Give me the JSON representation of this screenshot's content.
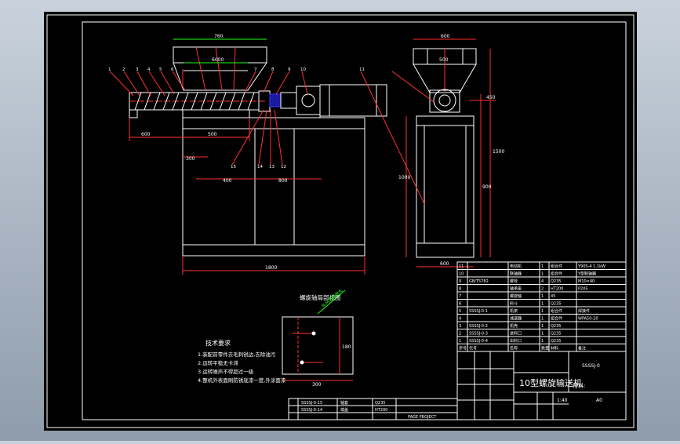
{
  "title_block": {
    "title": "10型螺旋输送机",
    "drawing_no": "SSSSJ-0",
    "material_label": "材料:",
    "sheet_marks": [
      "A0",
      "1:40"
    ]
  },
  "notes": {
    "heading": "技术要求",
    "items": [
      "1.装配前零件去毛刺锐边,去除油污",
      "2.运转平稳无卡滞",
      "3.运转噪声不得超过一级",
      "4.整机外表面刷防锈底漆一度,外涂面漆"
    ]
  },
  "detail": {
    "title": "螺旋轴局部视图",
    "callout": "N-M局部放大",
    "width_label": "300",
    "height_label": "180"
  },
  "main_dims": {
    "hopper_top": "760",
    "hopper_inner": "6000",
    "left_span": "600",
    "base_height": "300",
    "base_width": "400",
    "mid_width": "800",
    "total_length": "1800",
    "mid_label": "500"
  },
  "side_dims": {
    "top_width": "600",
    "inner_width": "500",
    "total_height": "1500",
    "frame_height": "900",
    "base_height": "1000",
    "bottom_width": "600",
    "gear_label": "450"
  },
  "balloons": {
    "left": [
      "1",
      "2",
      "3",
      "4",
      "5",
      "6",
      "7",
      "8"
    ],
    "right": [
      "9",
      "10"
    ],
    "bottom": [
      "15",
      "14",
      "13",
      "12"
    ],
    "side": [
      "11"
    ]
  },
  "parts_list": {
    "rows": [
      {
        "no": "11",
        "code": "",
        "name": "电动机",
        "qty": "1",
        "mat": "组合件",
        "note": "Y90S-4 1.1kW"
      },
      {
        "no": "10",
        "code": "",
        "name": "联轴器",
        "qty": "1",
        "mat": "组合件",
        "note": "Y型联轴器"
      },
      {
        "no": "9",
        "code": "GB/T5782",
        "name": "螺栓",
        "qty": "4",
        "mat": "Q235",
        "note": "M10×40"
      },
      {
        "no": "8",
        "code": "",
        "name": "轴承座",
        "qty": "2",
        "mat": "HT200",
        "note": "P205"
      },
      {
        "no": "7",
        "code": "",
        "name": "螺旋轴",
        "qty": "1",
        "mat": "45",
        "note": ""
      },
      {
        "no": "6",
        "code": "",
        "name": "料斗",
        "qty": "1",
        "mat": "Q235",
        "note": ""
      },
      {
        "no": "5",
        "code": "SSSSJ-0-1",
        "name": "机架",
        "qty": "1",
        "mat": "组合件",
        "note": "焊接件"
      },
      {
        "no": "4",
        "code": "",
        "name": "减速器",
        "qty": "1",
        "mat": "组合件",
        "note": "WPA50-20"
      },
      {
        "no": "3",
        "code": "SSSSJ-0-2",
        "name": "机壳",
        "qty": "1",
        "mat": "Q235",
        "note": ""
      },
      {
        "no": "2",
        "code": "SSSSJ-0-3",
        "name": "进料口",
        "qty": "1",
        "mat": "Q235",
        "note": ""
      },
      {
        "no": "1",
        "code": "SSSSJ-0-4",
        "name": "出料口",
        "qty": "1",
        "mat": "Q235",
        "note": ""
      }
    ],
    "header": {
      "no": "序号",
      "code": "代号",
      "name": "名称",
      "qty": "数量",
      "mat": "材料",
      "note": "备注"
    }
  },
  "bottom_list": {
    "rows": [
      {
        "code": "SSSSJ-0-15",
        "name": "轴套",
        "mat": "Q235"
      },
      {
        "code": "SSSSJ-0-14",
        "name": "端盖",
        "mat": "HT200"
      }
    ],
    "footer": "PAGE PROJECT"
  },
  "colors": {
    "paper": "#000000",
    "line": "#ffffff",
    "red": "#ff3030",
    "blue": "#3a3aff",
    "green": "#20ff20",
    "yellow": "#ffff00"
  }
}
